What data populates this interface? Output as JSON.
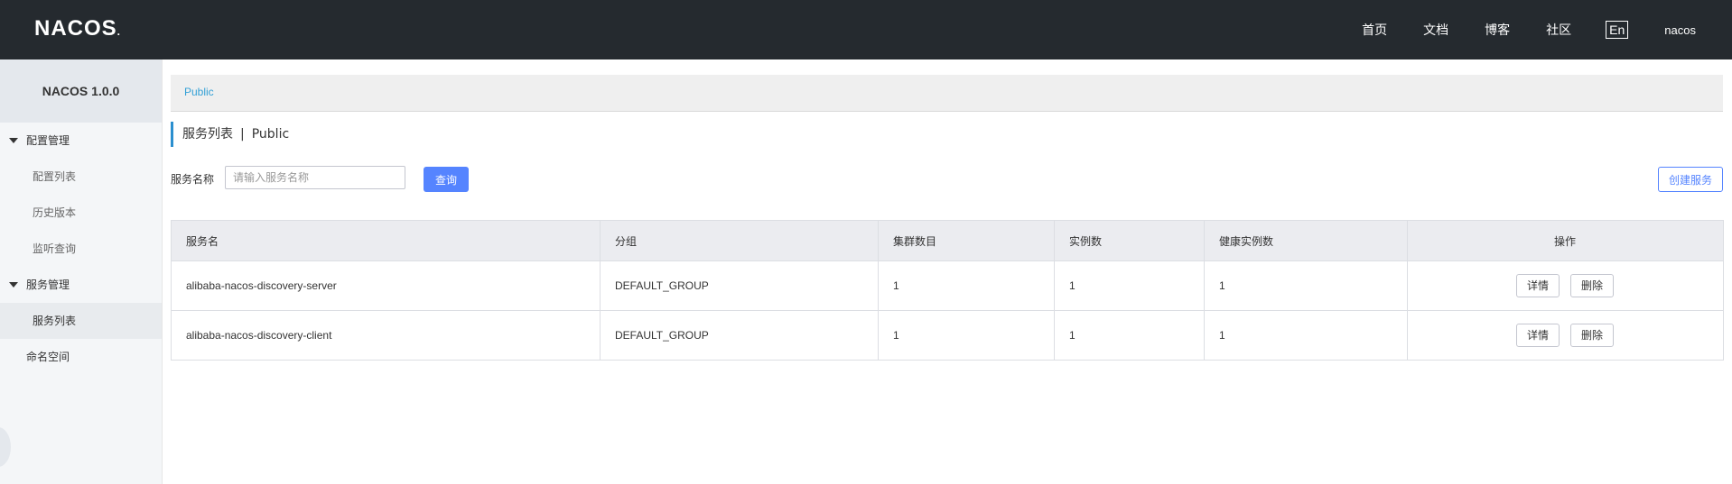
{
  "header": {
    "logo": "NACOS",
    "logo_suffix": ".",
    "nav": [
      "首页",
      "文档",
      "博客",
      "社区"
    ],
    "lang": "En",
    "user": "nacos"
  },
  "sidebar": {
    "title": "NACOS 1.0.0",
    "groups": [
      {
        "label": "配置管理",
        "items": [
          "配置列表",
          "历史版本",
          "监听查询"
        ]
      },
      {
        "label": "服务管理",
        "items": [
          "服务列表"
        ]
      }
    ],
    "active_item": "服务列表",
    "namespace_label": "命名空间"
  },
  "namespace": {
    "current": "Public"
  },
  "page": {
    "title": "服务列表",
    "separator": "|",
    "namespace": "Public"
  },
  "search": {
    "label": "服务名称",
    "placeholder": "请输入服务名称",
    "value": "",
    "query_button": "查询",
    "create_button": "创建服务"
  },
  "table": {
    "columns": [
      "服务名",
      "分组",
      "集群数目",
      "实例数",
      "健康实例数",
      "操作"
    ],
    "rows": [
      {
        "name": "alibaba-nacos-discovery-server",
        "group": "DEFAULT_GROUP",
        "clusters": "1",
        "instances": "1",
        "healthy": "1"
      },
      {
        "name": "alibaba-nacos-discovery-client",
        "group": "DEFAULT_GROUP",
        "clusters": "1",
        "instances": "1",
        "healthy": "1"
      }
    ],
    "detail_label": "详情",
    "delete_label": "删除"
  },
  "colors": {
    "header_bg": "#252a2f",
    "accent": "#5584ff",
    "link": "#33a0d6",
    "sidebar_bg": "#f4f6f8"
  }
}
